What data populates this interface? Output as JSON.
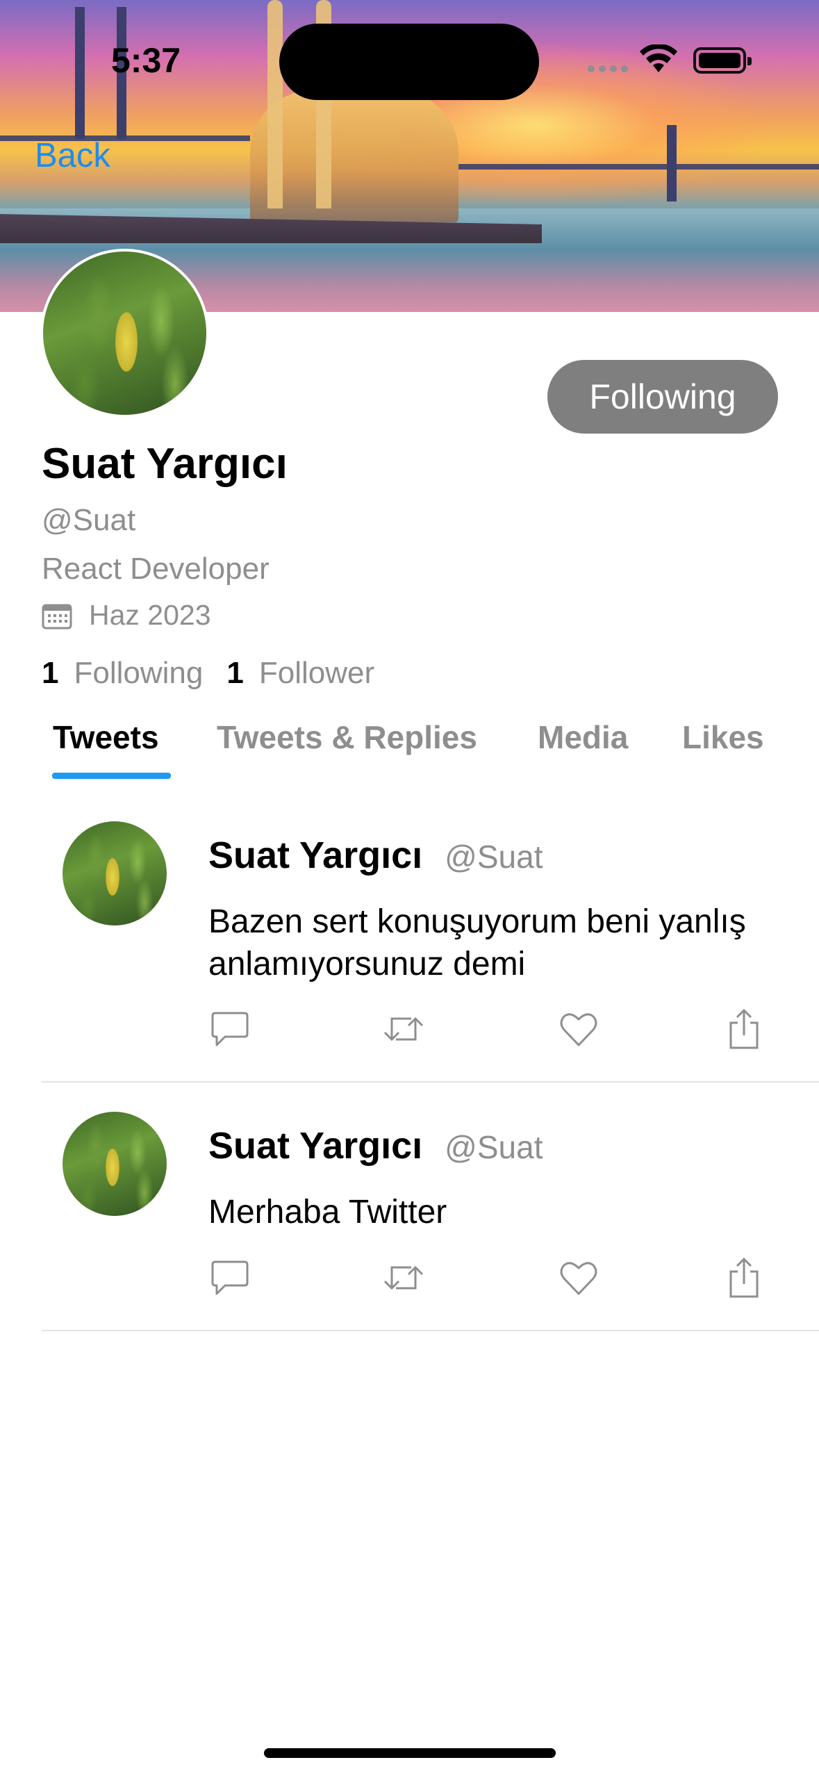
{
  "status_bar": {
    "time": "5:37"
  },
  "nav": {
    "back_label": "Back"
  },
  "profile": {
    "display_name": "Suat Yargıcı",
    "handle": "@Suat",
    "bio": "React Developer",
    "joined": "Haz 2023",
    "follow_button_label": "Following",
    "following_count": "1",
    "following_label": "Following",
    "followers_count": "1",
    "followers_label": "Follower"
  },
  "tabs": [
    {
      "label": "Tweets",
      "active": true
    },
    {
      "label": "Tweets & Replies",
      "active": false
    },
    {
      "label": "Media",
      "active": false
    },
    {
      "label": "Likes",
      "active": false
    }
  ],
  "tweets": [
    {
      "name": "Suat Yargıcı",
      "handle": "@Suat",
      "text": "Bazen sert konuşuyorum beni yanlış anlamıyorsunuz demi"
    },
    {
      "name": "Suat Yargıcı",
      "handle": "@Suat",
      "text": "Merhaba Twitter"
    }
  ],
  "icons": {
    "reply": "comment-icon",
    "retweet": "retweet-icon",
    "like": "heart-icon",
    "share": "share-icon",
    "calendar": "calendar-icon"
  },
  "colors": {
    "accent": "#1d9bf0",
    "back_link": "#1d8cf0",
    "muted_text": "#8e8e8e",
    "follow_button_bg": "#7f7f7f"
  }
}
